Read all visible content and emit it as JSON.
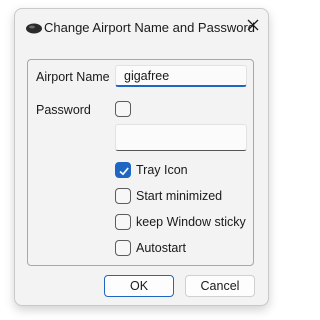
{
  "window": {
    "title": "Change Airport Name and Password",
    "app_icon": "airport-cloud-icon",
    "close_icon": "close-icon"
  },
  "form": {
    "airport_name_label": "Airport Name",
    "airport_name_value": "gigafree",
    "password_label": "Password",
    "password_checkbox_checked": false,
    "password_value": ""
  },
  "options": [
    {
      "label": "Tray Icon",
      "checked": true
    },
    {
      "label": "Start minimized",
      "checked": false
    },
    {
      "label": "keep Window sticky",
      "checked": false
    },
    {
      "label": "Autostart",
      "checked": false
    }
  ],
  "buttons": {
    "ok_label": "OK",
    "cancel_label": "Cancel"
  },
  "colors": {
    "accent": "#1f66c4",
    "window_bg": "#f3f3f3"
  }
}
